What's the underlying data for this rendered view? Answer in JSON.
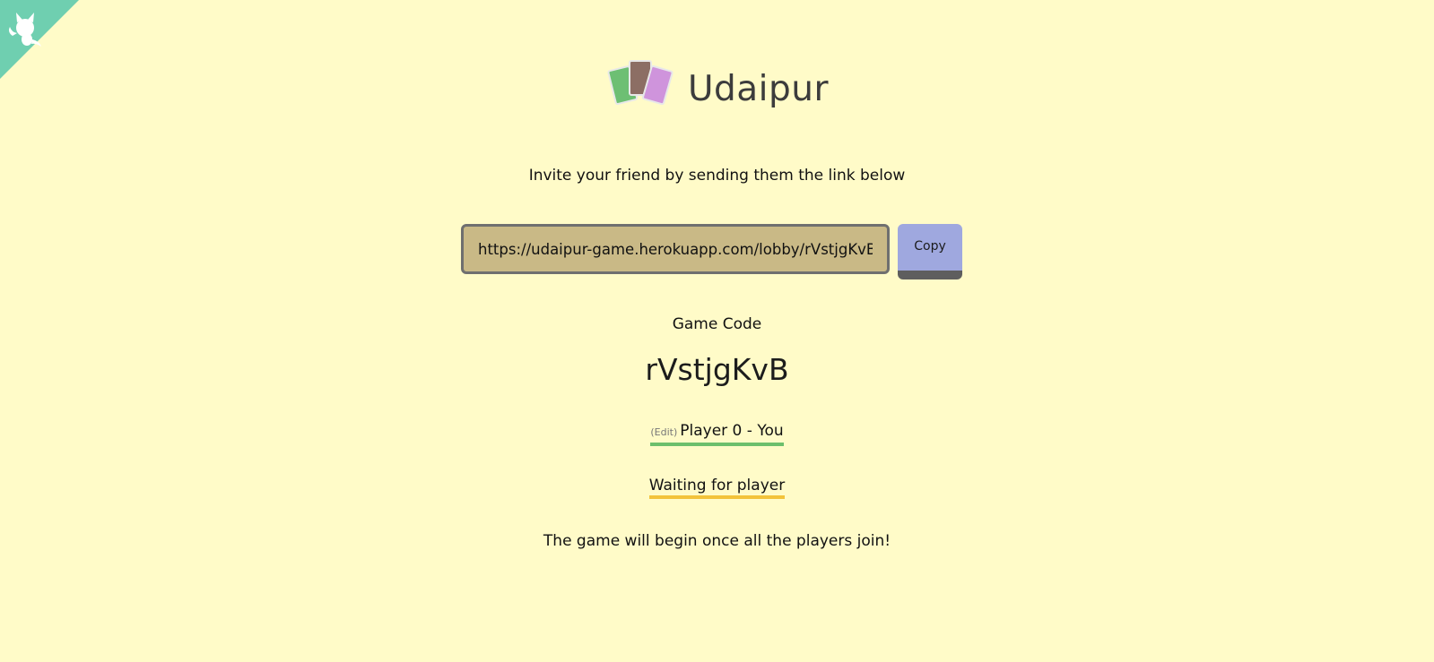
{
  "corner": {
    "icon": "github-octocat-icon",
    "color": "#6fcfb0"
  },
  "header": {
    "logo_icon": "cards-logo-icon",
    "title": "Udaipur"
  },
  "invite": {
    "text": "Invite your friend by sending them the link below",
    "link_value": "https://udaipur-game.herokuapp.com/lobby/rVstjgKvB",
    "copy_label": "Copy"
  },
  "game": {
    "code_label": "Game Code",
    "code": "rVstjgKvB"
  },
  "players": {
    "edit_label": "(Edit)",
    "self_name": "Player 0 - You",
    "waiting_label": "Waiting for player"
  },
  "footer": {
    "begin_text": "The game will begin once all the players join!"
  },
  "colors": {
    "background": "#fffbc8",
    "input_background": "#c9b986",
    "copy_button": "#9fa8df",
    "player_underline": "#6cbf6c",
    "waiting_underline": "#f3c33a"
  }
}
